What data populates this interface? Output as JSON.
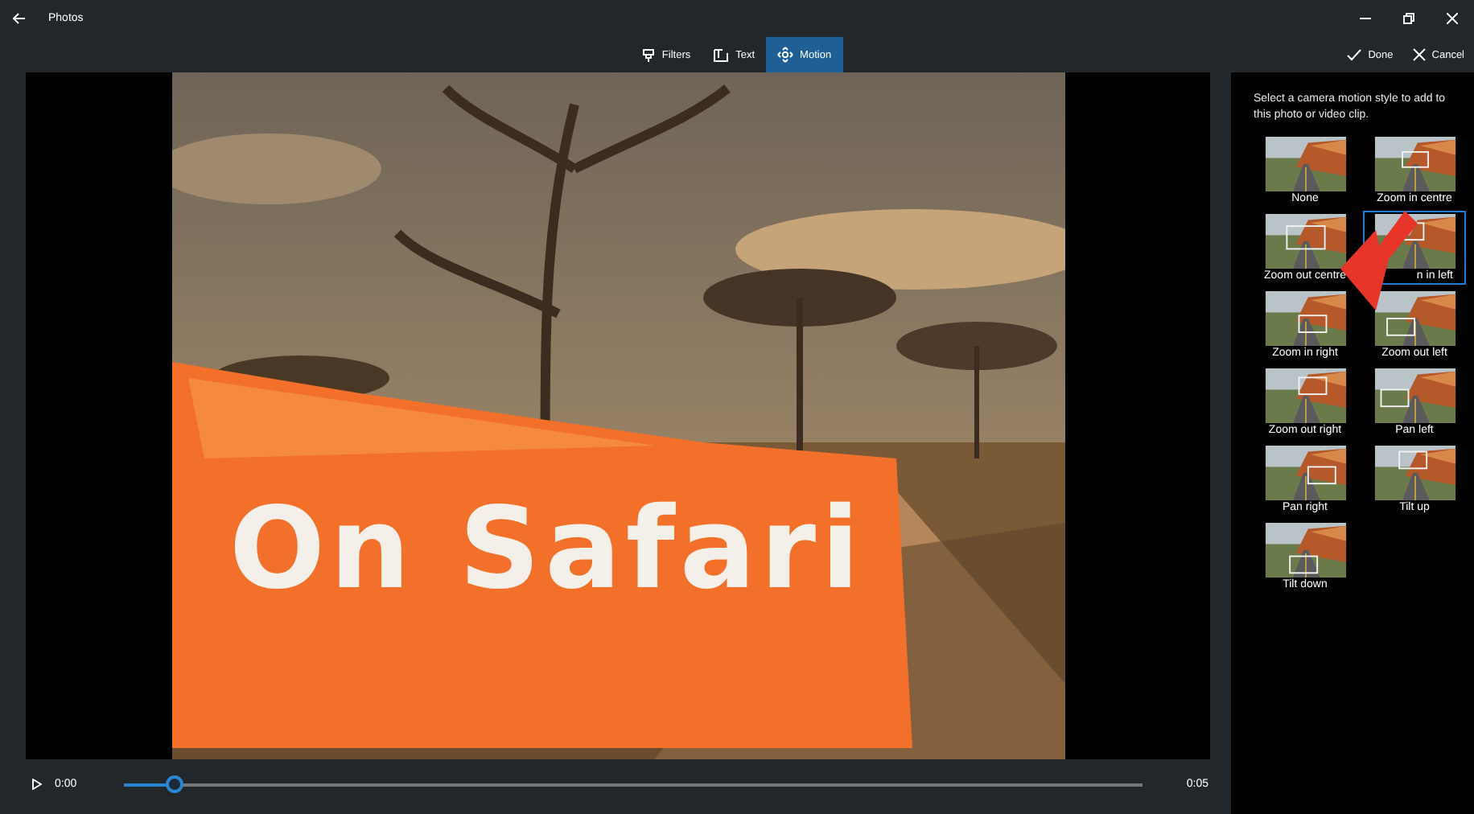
{
  "window": {
    "title": "Photos"
  },
  "tabs": [
    {
      "label": "Filters",
      "kind": "filter",
      "selected": false
    },
    {
      "label": "Text",
      "kind": "text",
      "selected": false
    },
    {
      "label": "Motion",
      "kind": "motion",
      "selected": true
    }
  ],
  "actions": [
    {
      "label": "Done",
      "kind": "done"
    },
    {
      "label": "Cancel",
      "kind": "cancel"
    }
  ],
  "preview": {
    "kind": "picture",
    "title_overlay": "On Safari"
  },
  "playback": {
    "current_time": "0:00",
    "duration": "0:05",
    "level": 0.05
  },
  "panel": {
    "instruction": "Select a camera motion style to add to this photo or video clip.",
    "motions": [
      {
        "label": "None",
        "selected": false
      },
      {
        "label": "Zoom in centre",
        "selected": false
      },
      {
        "label": "Zoom out centre",
        "selected": false
      },
      {
        "label": "n in left",
        "selected": true
      },
      {
        "label": "Zoom in right",
        "selected": false
      },
      {
        "label": "Zoom out left",
        "selected": false
      },
      {
        "label": "Zoom out right",
        "selected": false
      },
      {
        "label": "Pan left",
        "selected": false
      },
      {
        "label": "Pan right",
        "selected": false
      },
      {
        "label": "Tilt up",
        "selected": false
      },
      {
        "label": "Tilt down",
        "selected": false
      }
    ]
  }
}
